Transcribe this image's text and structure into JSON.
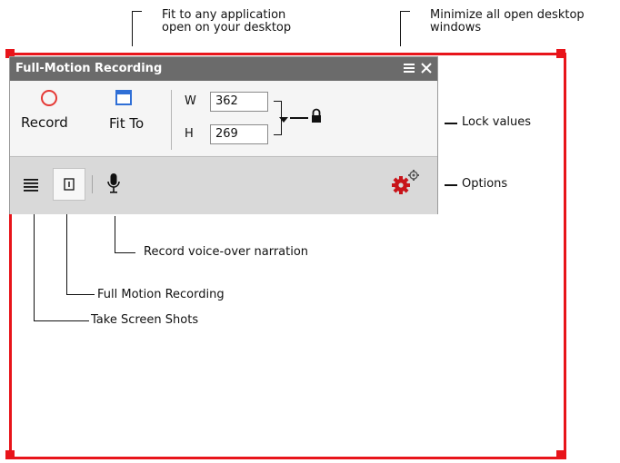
{
  "callouts": {
    "fit_to": "Fit to any application open on your desktop",
    "fit_to_line1": "Fit to any application",
    "fit_to_line2": "open on your desktop",
    "minimize_line1": "Minimize all open  desktop",
    "minimize_line2": "windows",
    "lock_values": "Lock values",
    "options": "Options",
    "voice_over": "Record voice-over narration",
    "full_motion": "Full Motion Recording",
    "screen_shots": "Take Screen Shots"
  },
  "panel": {
    "title": "Full-Motion Recording",
    "menu_icon": "hamburger-icon",
    "close_icon": "close-icon",
    "record_label": "Record",
    "fit_to_label": "Fit To",
    "width_label": "W",
    "width_value": "362",
    "height_label": "H",
    "height_value": "269",
    "dropdown_icon": "chevron-down-icon",
    "lock_icon": "lock-icon",
    "toolbar_icons": [
      "list-icon",
      "full-motion-icon",
      "microphone-icon",
      "options-gear-icon"
    ]
  },
  "colors": {
    "frame_red": "#e8141a",
    "title_bar": "#6b6b6b",
    "record_circle": "#e53935",
    "fit_blue": "#2f6fd6"
  }
}
